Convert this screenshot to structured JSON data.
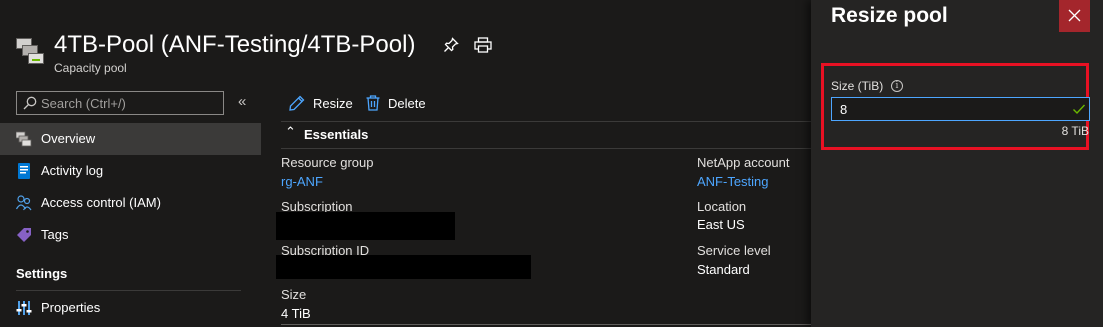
{
  "header": {
    "title": "4TB-Pool (ANF-Testing/4TB-Pool)",
    "subtitle": "Capacity pool",
    "icons": [
      "capacity-pool-icon",
      "pin-icon",
      "print-icon"
    ]
  },
  "sidebar": {
    "search_placeholder": "Search (Ctrl+/)",
    "collapse_label": "«",
    "items": [
      {
        "label": "Overview",
        "icon": "overview-icon",
        "selected": true
      },
      {
        "label": "Activity log",
        "icon": "activity-log-icon"
      },
      {
        "label": "Access control (IAM)",
        "icon": "iam-icon"
      },
      {
        "label": "Tags",
        "icon": "tag-icon"
      }
    ],
    "section_heading": "Settings",
    "settings_items": [
      {
        "label": "Properties",
        "icon": "properties-icon"
      }
    ]
  },
  "toolbar": {
    "resize_label": "Resize",
    "delete_label": "Delete"
  },
  "essentials": {
    "label": "Essentials",
    "chevron": "⌃",
    "resource_group_label": "Resource group",
    "resource_group_value": "rg-ANF",
    "subscription_label": "Subscription",
    "subscription_id_label": "Subscription ID",
    "size_label": "Size",
    "size_value": "4 TiB",
    "netapp_account_label": "NetApp account",
    "netapp_account_value": "ANF-Testing",
    "location_label": "Location",
    "location_value": "East US",
    "service_level_label": "Service level",
    "service_level_value": "Standard"
  },
  "resize_panel": {
    "title": "Resize pool",
    "size_field_label": "Size (TiB)",
    "info_glyph": "i",
    "size_value": "8",
    "size_hint": "8 TiB"
  },
  "colors": {
    "background": "#1b1a19",
    "panel": "#252423",
    "accent_link": "#4da6ff",
    "close_button": "#a4262c",
    "highlight_border": "#e81123",
    "valid_check": "#6bb700"
  }
}
